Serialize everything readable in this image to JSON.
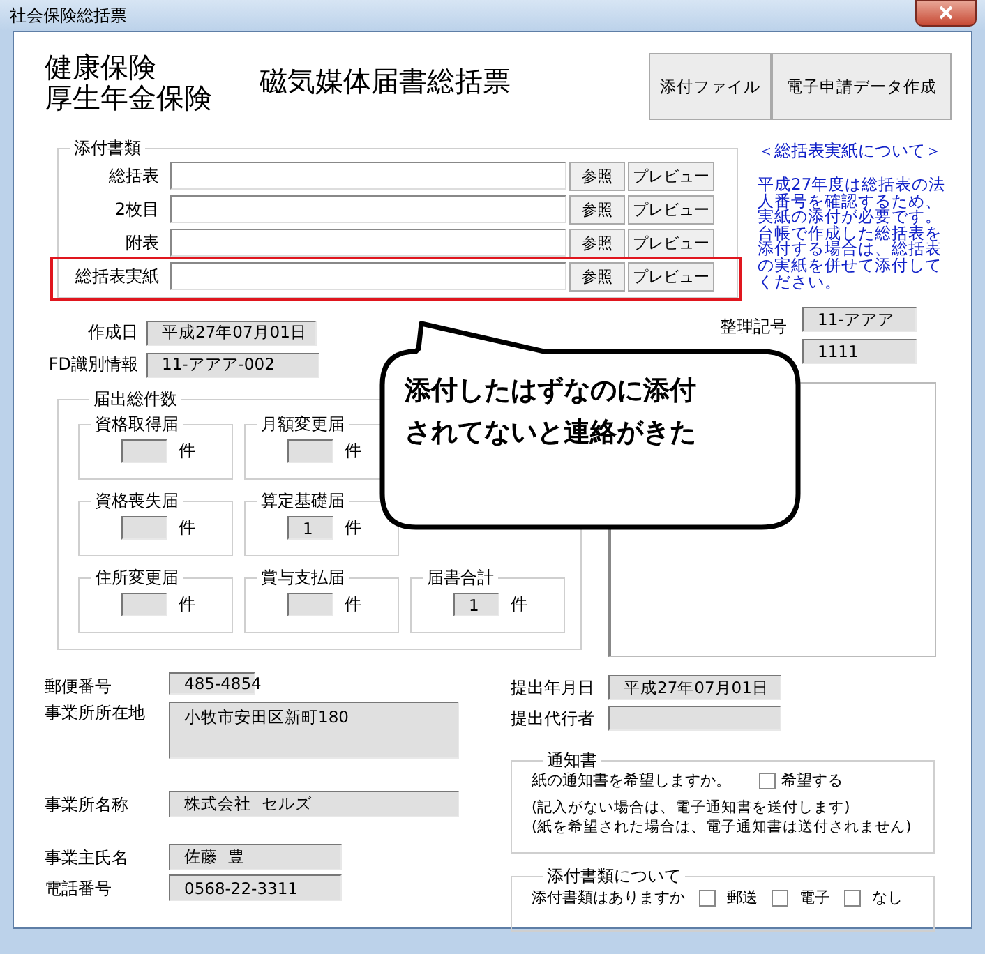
{
  "window": {
    "title": "社会保険総括票"
  },
  "header": {
    "insurance_lines": [
      "健康保険",
      "厚生年金保険"
    ],
    "form_title": "磁気媒体届書総括票",
    "buttons": [
      "添付ファイル",
      "電子申請データ作成"
    ]
  },
  "attachments": {
    "legend": "添付書類",
    "rows": [
      {
        "label": "総括表",
        "browse": "参照",
        "preview": "プレビュー",
        "highlighted": false
      },
      {
        "label": "2枚目",
        "browse": "参照",
        "preview": "プレビュー",
        "highlighted": false
      },
      {
        "label": "附表",
        "browse": "参照",
        "preview": "プレビュー",
        "highlighted": false
      },
      {
        "label": "総括表実紙",
        "browse": "参照",
        "preview": "プレビュー",
        "highlighted": true
      }
    ]
  },
  "note": {
    "heading": "＜総括表実紙について＞",
    "text": "平成27年度は総括表の法人番号を確認するため、実紙の添付が必要です。台帳で作成した総括表を添付する場合は、総括表の実紙を併せて添付してください。"
  },
  "created": {
    "label": "作成日",
    "value": "平成27年07月01日"
  },
  "fd_id": {
    "label": "FD識別情報",
    "value": "11-アアア-002"
  },
  "reference": {
    "label": "整理記号",
    "values": [
      "11-アアア",
      "1111"
    ]
  },
  "counts": {
    "legend": "届出総件数",
    "items": [
      {
        "label": "資格取得届",
        "unit": "件"
      },
      {
        "label": "月額変更届",
        "unit": "件"
      },
      {
        "label": "資格喪失届",
        "unit": "件"
      },
      {
        "label": "算定基礎届",
        "value": "1",
        "unit": "件"
      },
      {
        "label": "住所変更届",
        "unit": "件"
      },
      {
        "label": "賞与支払届",
        "unit": "件"
      },
      {
        "label": "届書合計",
        "value": "1",
        "unit": "件"
      }
    ]
  },
  "office": [
    {
      "label": "郵便番号",
      "value": "485-4854",
      "kind": "short"
    },
    {
      "label": "事業所所在地",
      "value": "小牧市安田区新町180",
      "kind": "area"
    },
    {
      "label": "事業所名称",
      "value": "株式会社  セルズ",
      "kind": "wide"
    },
    {
      "label": "事業主氏名",
      "value": "佐藤  豊",
      "kind": "medium"
    },
    {
      "label": "電話番号",
      "value": "0568-22-3311",
      "kind": "medium"
    }
  ],
  "submission": [
    {
      "label": "提出年月日",
      "value": "平成27年07月01日"
    },
    {
      "label": "提出代行者"
    }
  ],
  "notice": {
    "legend": "通知書",
    "question": "紙の通知書を希望しますか。",
    "option": {
      "label": "希望する",
      "checked": false
    },
    "notes": [
      "(記入がない場合は、電子通知書を送付します)",
      "(紙を希望された場合は、電子通知書は送付されません)"
    ]
  },
  "attachment_method": {
    "legend": "添付書類について",
    "question": "添付書類はありますか",
    "options": [
      {
        "label": "郵送",
        "checked": false
      },
      {
        "label": "電子",
        "checked": false
      },
      {
        "label": "なし",
        "checked": false
      }
    ]
  },
  "callout": {
    "lines": [
      "添付したはずなのに添付",
      "されてないと連絡がきた"
    ]
  }
}
